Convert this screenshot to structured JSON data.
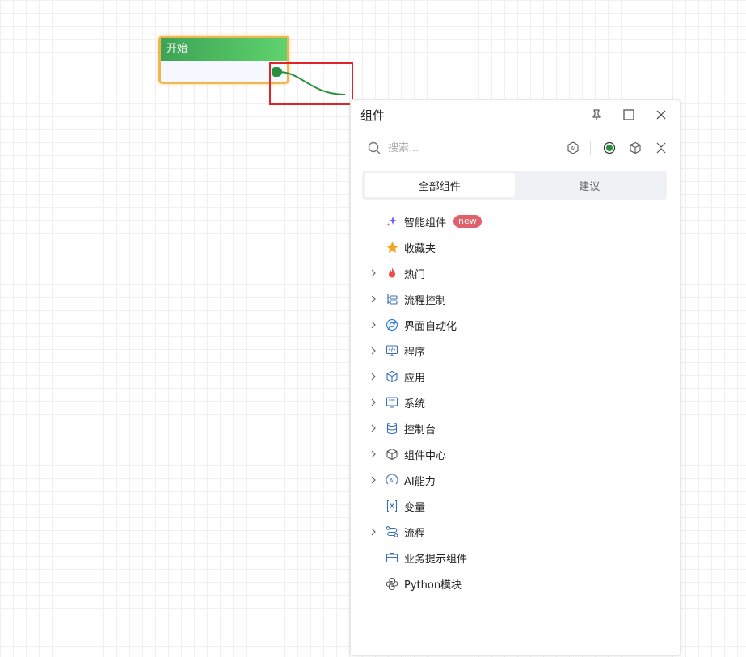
{
  "canvas": {
    "start_node": {
      "title": "开始"
    }
  },
  "panel": {
    "title": "组件",
    "header_buttons": [
      "pin-icon",
      "maximize-icon",
      "close-icon"
    ],
    "search": {
      "placeholder": "搜索..."
    },
    "search_tools": [
      "ai-icon",
      "record-icon",
      "box-icon",
      "collapse-icon"
    ],
    "tabs": [
      {
        "label": "全部组件",
        "active": true
      },
      {
        "label": "建议",
        "active": false
      }
    ],
    "tree": [
      {
        "label": "智能组件",
        "icon": "sparkle-icon",
        "expandable": false,
        "badge": "new"
      },
      {
        "label": "收藏夹",
        "icon": "star-icon",
        "expandable": false
      },
      {
        "label": "热门",
        "icon": "fire-icon",
        "expandable": true
      },
      {
        "label": "流程控制",
        "icon": "flow-control-icon",
        "expandable": true
      },
      {
        "label": "界面自动化",
        "icon": "ui-automation-icon",
        "expandable": true
      },
      {
        "label": "程序",
        "icon": "program-icon",
        "expandable": true
      },
      {
        "label": "应用",
        "icon": "app-cube-icon",
        "expandable": true
      },
      {
        "label": "系统",
        "icon": "system-icon",
        "expandable": true
      },
      {
        "label": "控制台",
        "icon": "database-icon",
        "expandable": true
      },
      {
        "label": "组件中心",
        "icon": "component-center-icon",
        "expandable": true
      },
      {
        "label": "AI能力",
        "icon": "ai-ability-icon",
        "expandable": true
      },
      {
        "label": "变量",
        "icon": "variable-icon",
        "expandable": false
      },
      {
        "label": "流程",
        "icon": "process-icon",
        "expandable": true
      },
      {
        "label": "业务提示组件",
        "icon": "business-tip-icon",
        "expandable": false
      },
      {
        "label": "Python模块",
        "icon": "python-icon",
        "expandable": false
      }
    ]
  },
  "colors": {
    "start_header": "#3ea355",
    "start_border": "#f1b54e",
    "edge": "#26903c",
    "highlight": "#e0242b",
    "badge": "#e2606b"
  }
}
